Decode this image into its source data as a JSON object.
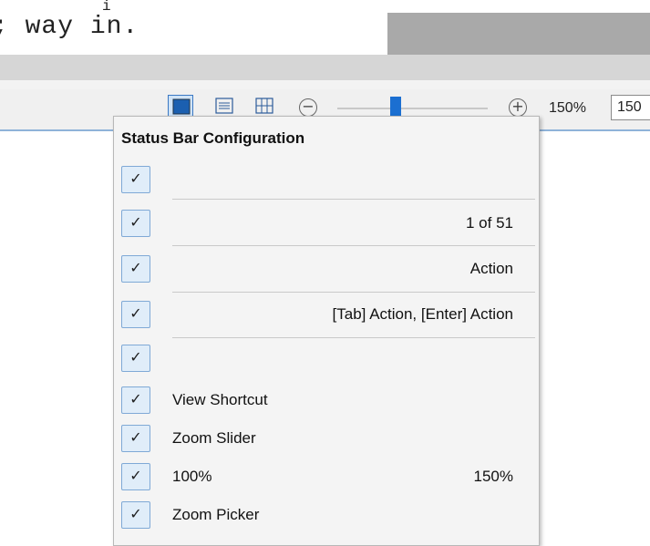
{
  "document": {
    "line": "; way in.",
    "tick": "i"
  },
  "statusbar": {
    "zoom_minus": "−",
    "zoom_plus": "+",
    "zoom_level": "150%",
    "zoom_picker_value": "150"
  },
  "menu": {
    "title": "Status Bar Configuration",
    "check_glyph": "✓",
    "rows": [
      {
        "label": "",
        "value": "",
        "checked": true
      },
      {
        "label": "",
        "value": "1  of 51",
        "checked": true
      },
      {
        "label": "",
        "value": "Action",
        "checked": true
      },
      {
        "label": "",
        "value": "[Tab]  Action,  [Enter] Action",
        "checked": true
      },
      {
        "label": "",
        "value": "",
        "checked": true
      },
      {
        "label": "View Shortcut",
        "value": "",
        "checked": true
      },
      {
        "label": "Zoom Slider",
        "value": "",
        "checked": true
      },
      {
        "label": "100%",
        "value": "150%",
        "checked": true
      },
      {
        "label": "Zoom Picker",
        "value": "",
        "checked": true
      }
    ]
  },
  "colors": {
    "accent": "#1b6fd1",
    "check_bg": "#e0edf9",
    "menu_bg": "#f4f4f4"
  }
}
